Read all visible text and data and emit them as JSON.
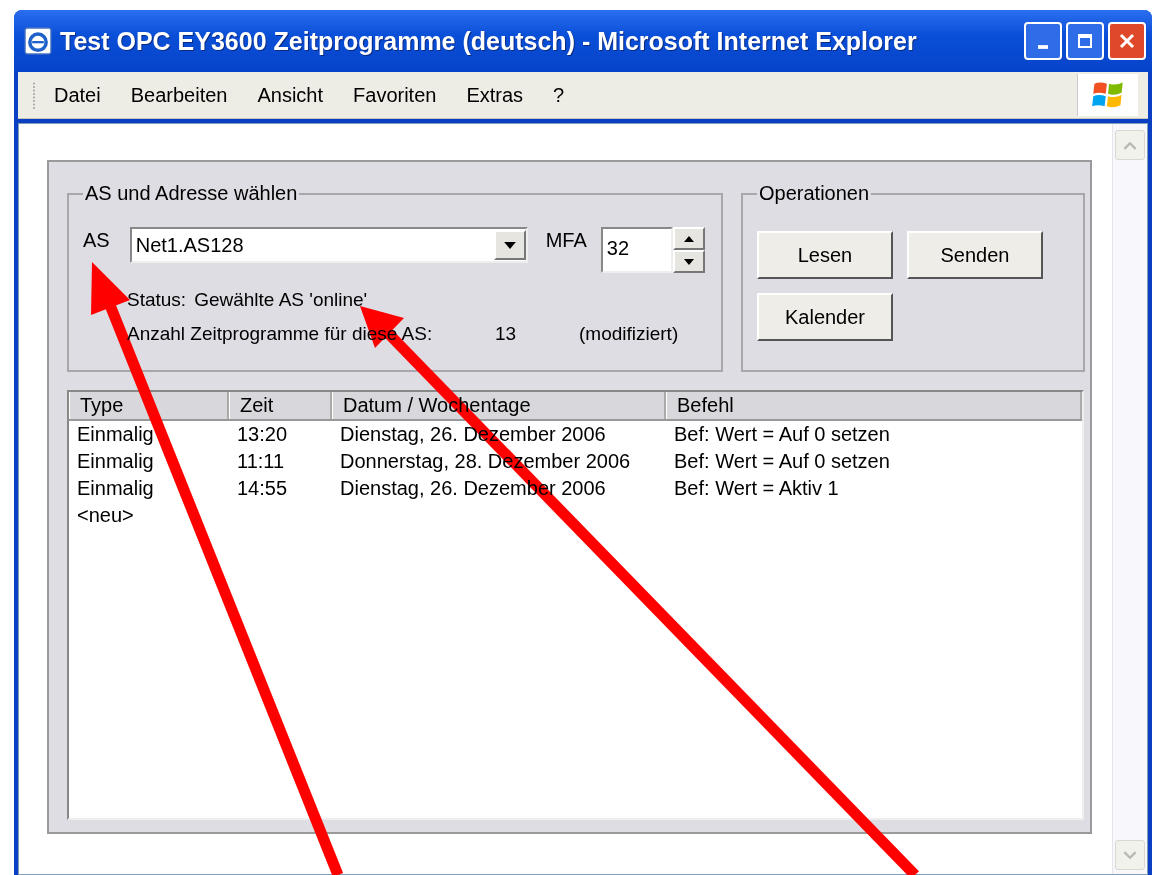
{
  "window": {
    "title": "Test OPC EY3600 Zeitprogramme (deutsch) - Microsoft Internet Explorer"
  },
  "menu": [
    "Datei",
    "Bearbeiten",
    "Ansicht",
    "Favoriten",
    "Extras",
    "?"
  ],
  "select_group": {
    "legend": "AS und Adresse wählen",
    "as_label": "AS",
    "as_value": "Net1.AS128",
    "mfa_label": "MFA",
    "mfa_value": "32",
    "status_label": "Status:",
    "status_text": "Gewählte AS 'online'",
    "count_label": "Anzahl Zeitprogramme für diese AS:",
    "count_value": "13",
    "count_note": "(modifiziert)"
  },
  "operations": {
    "legend": "Operationen",
    "buttons": [
      "Lesen",
      "Senden",
      "Kalender"
    ]
  },
  "table": {
    "columns": [
      "Type",
      "Zeit",
      "Datum / Wochentage",
      "Befehl"
    ],
    "rows": [
      [
        "Einmalig",
        "13:20",
        "Dienstag, 26. Dezember 2006",
        "Bef: Wert = Auf 0 setzen"
      ],
      [
        "Einmalig",
        "11:11",
        "Donnerstag, 28. Dezember 2006",
        "Bef: Wert = Auf 0 setzen"
      ],
      [
        "Einmalig",
        "14:55",
        "Dienstag, 26. Dezember 2006",
        "Bef: Wert = Aktiv 1"
      ],
      [
        "<neu>"
      ]
    ]
  }
}
